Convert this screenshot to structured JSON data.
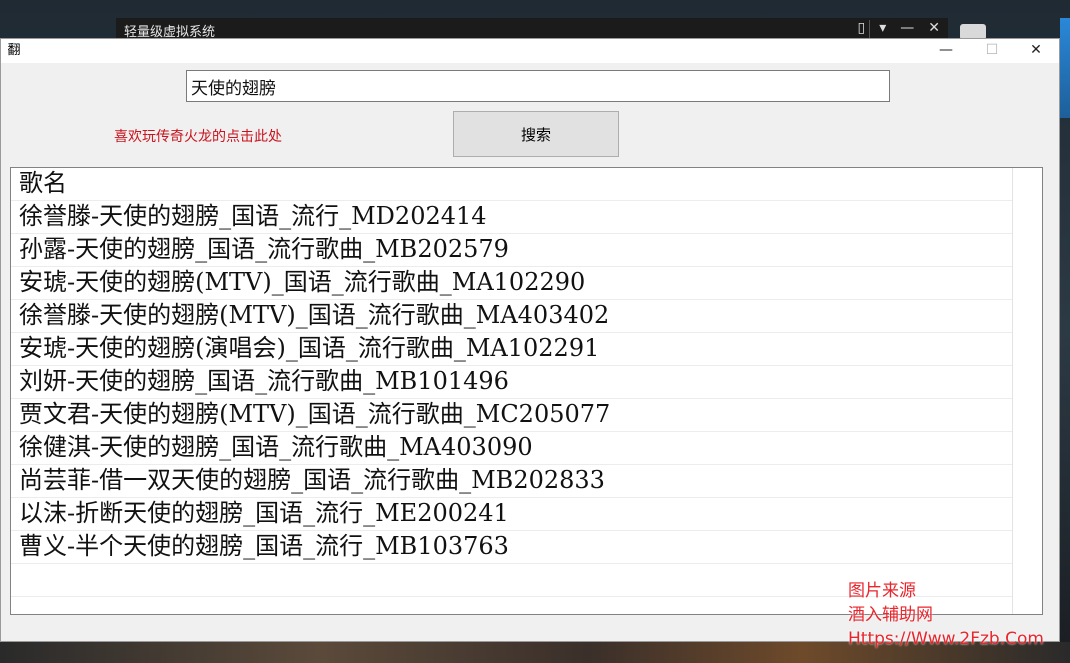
{
  "background": {
    "window_title": "轻量级虚拟系统",
    "window_controls": [
      "▯",
      "▾",
      "—",
      "✕"
    ]
  },
  "app": {
    "icon": "翻",
    "controls": {
      "minimize": "—",
      "maximize": "☐",
      "close": "✕"
    },
    "search": {
      "value": "天使的翅膀"
    },
    "promo_link": "喜欢玩传奇火龙的点击此处",
    "search_button": "搜索",
    "results": {
      "header": "歌名",
      "rows": [
        "徐誉滕-天使的翅膀_国语_流行_MD202414",
        "孙露-天使的翅膀_国语_流行歌曲_MB202579",
        "安琥-天使的翅膀(MTV)_国语_流行歌曲_MA102290",
        "徐誉滕-天使的翅膀(MTV)_国语_流行歌曲_MA403402",
        "安琥-天使的翅膀(演唱会)_国语_流行歌曲_MA102291",
        "刘妍-天使的翅膀_国语_流行歌曲_MB101496",
        "贾文君-天使的翅膀(MTV)_国语_流行歌曲_MC205077",
        "徐健淇-天使的翅膀_国语_流行歌曲_MA403090",
        "尚芸菲-借一双天使的翅膀_国语_流行歌曲_MB202833",
        "以沫-折断天使的翅膀_国语_流行_ME200241",
        "曹义-半个天使的翅膀_国语_流行_MB103763"
      ]
    }
  },
  "watermark": {
    "line1": "图片来源",
    "line2": "酒入辅助网",
    "line3": "Https://Www.2Fzb.Com"
  },
  "colors": {
    "promo": "#c8141e",
    "watermark": "#e8262d"
  }
}
